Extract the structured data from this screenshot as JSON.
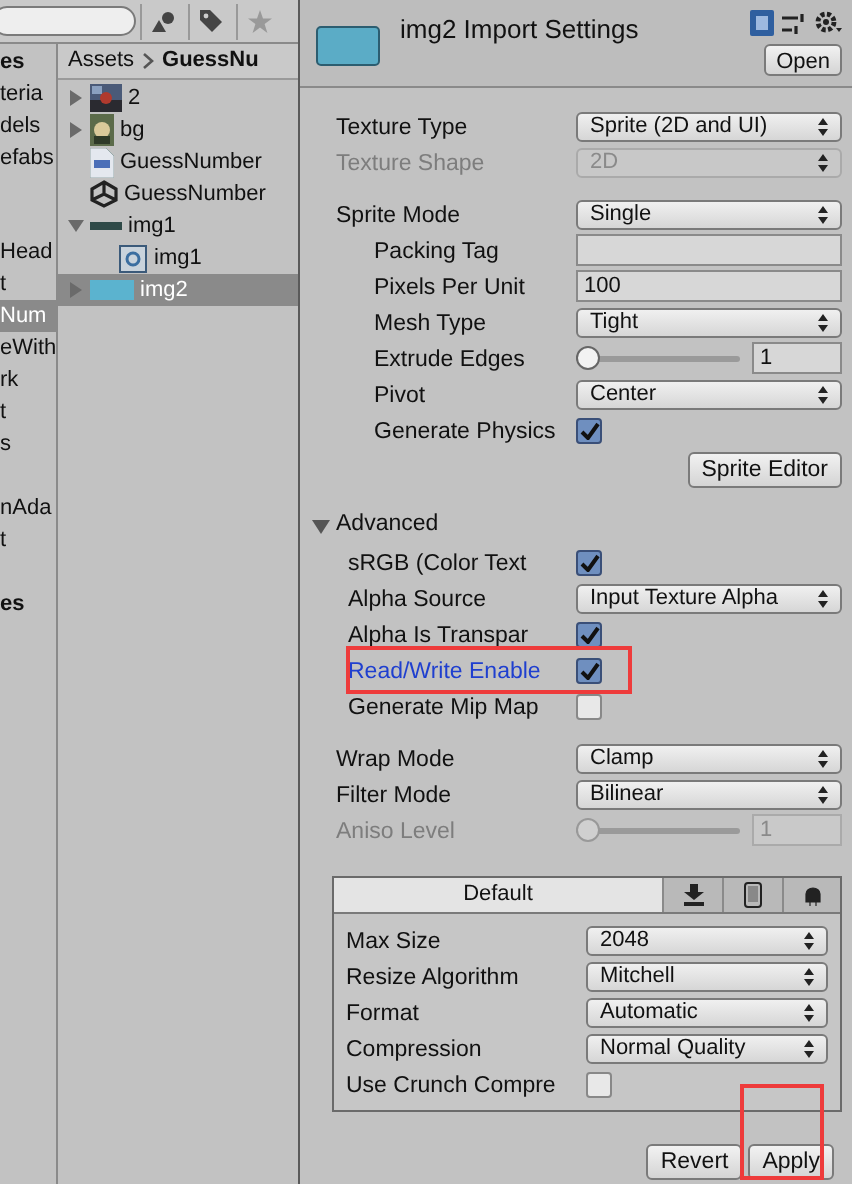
{
  "hierarchy": {
    "groups": [
      [
        {
          "label": "es",
          "kind": "header",
          "selected": false
        },
        {
          "label": "teria",
          "kind": "item",
          "selected": false
        },
        {
          "label": "dels",
          "kind": "item",
          "selected": false
        },
        {
          "label": "efabs",
          "kind": "item",
          "selected": false
        }
      ],
      [
        {
          "label": "Head",
          "kind": "item",
          "selected": false
        },
        {
          "label": "t",
          "kind": "item",
          "selected": false
        },
        {
          "label": "Num",
          "kind": "item",
          "selected": true
        },
        {
          "label": "eWith",
          "kind": "item",
          "selected": false
        },
        {
          "label": "rk",
          "kind": "item",
          "selected": false
        },
        {
          "label": "t",
          "kind": "item",
          "selected": false
        },
        {
          "label": "s",
          "kind": "item",
          "selected": false
        }
      ],
      [
        {
          "label": "nAda",
          "kind": "item",
          "selected": false
        },
        {
          "label": "t",
          "kind": "item",
          "selected": false
        }
      ],
      [
        {
          "label": "es",
          "kind": "header",
          "selected": false
        }
      ]
    ]
  },
  "project": {
    "breadcrumb": [
      {
        "label": "Assets",
        "current": false
      },
      {
        "label": "GuessNu",
        "current": true
      }
    ],
    "items": [
      {
        "label": "2",
        "expanded": false,
        "selected": false
      },
      {
        "label": "bg",
        "expanded": false,
        "selected": false
      },
      {
        "label": "GuessNumber",
        "kind": "script",
        "selected": false
      },
      {
        "label": "GuessNumber",
        "kind": "scene",
        "selected": false
      },
      {
        "label": "img1",
        "kind": "texture",
        "expanded": true,
        "selected": false,
        "children": [
          {
            "label": "img1",
            "kind": "sprite",
            "selected": false
          }
        ]
      },
      {
        "label": "img2",
        "kind": "texture2",
        "expanded": false,
        "selected": true
      }
    ]
  },
  "inspector": {
    "title": "img2 Import Settings",
    "open_button": "Open",
    "groups": [
      [
        {
          "kind": "dropdown",
          "label": "Texture Type",
          "value": "Sprite (2D and UI)",
          "disabled": false
        },
        {
          "kind": "dropdown",
          "label": "Texture Shape",
          "value": "2D",
          "disabled": true
        }
      ],
      [
        {
          "kind": "dropdown",
          "label": "Sprite Mode",
          "value": "Single",
          "disabled": false,
          "children": [
            {
              "kind": "text",
              "label": "Packing Tag"
            },
            {
              "kind": "text",
              "label": "Pixels Per Unit",
              "value": "100"
            },
            {
              "kind": "dropdown",
              "label": "Mesh Type",
              "value": "Tight",
              "disabled": false
            },
            {
              "kind": "slider",
              "label": "Extrude Edges",
              "level": 0,
              "value": "1",
              "disabled": false
            },
            {
              "kind": "dropdown",
              "label": "Pivot",
              "value": "Center",
              "disabled": false
            },
            {
              "kind": "checkbox",
              "label": "Generate Physics",
              "checked": true,
              "highlighted": false
            }
          ]
        },
        {
          "kind": "button",
          "label": "Sprite Editor"
        }
      ],
      [
        {
          "kind": "foldout",
          "label": "Advanced",
          "expanded": true,
          "children": [
            {
              "kind": "checkbox",
              "label": "sRGB (Color Text",
              "checked": true,
              "highlighted": false
            },
            {
              "kind": "dropdown",
              "label": "Alpha Source",
              "value": "Input Texture Alpha",
              "disabled": false
            },
            {
              "kind": "checkbox",
              "label": "Alpha Is Transpar",
              "checked": true,
              "highlighted": false
            },
            {
              "kind": "checkbox",
              "label": "Read/Write Enable",
              "checked": true,
              "highlighted": true
            },
            {
              "kind": "checkbox",
              "label": "Generate Mip Map",
              "checked": false,
              "highlighted": false
            }
          ]
        }
      ],
      [
        {
          "kind": "dropdown",
          "label": "Wrap Mode",
          "value": "Clamp",
          "disabled": false
        },
        {
          "kind": "dropdown",
          "label": "Filter Mode",
          "value": "Bilinear",
          "disabled": false
        },
        {
          "kind": "slider",
          "label": "Aniso Level",
          "level": 0,
          "value": "1",
          "disabled": true
        }
      ]
    ],
    "platform": {
      "tabs": [
        {
          "kind": "text",
          "label": "Default",
          "selected": true
        },
        {
          "kind": "download",
          "selected": false
        },
        {
          "kind": "phone",
          "selected": false
        },
        {
          "kind": "android",
          "selected": false
        }
      ],
      "rows": [
        {
          "kind": "dropdown",
          "label": "Max Size",
          "value": "2048",
          "disabled": false
        },
        {
          "kind": "dropdown",
          "label": "Resize Algorithm",
          "value": "Mitchell",
          "disabled": false
        },
        {
          "kind": "dropdown",
          "label": "Format",
          "value": "Automatic",
          "disabled": false
        },
        {
          "kind": "dropdown",
          "label": "Compression",
          "value": "Normal Quality",
          "disabled": false
        },
        {
          "kind": "checkbox",
          "label": "Use Crunch Compre",
          "checked": false,
          "highlighted": false
        }
      ]
    },
    "buttons": [
      {
        "label": "Revert",
        "highlighted": false
      },
      {
        "label": "Apply",
        "highlighted": true
      }
    ]
  }
}
